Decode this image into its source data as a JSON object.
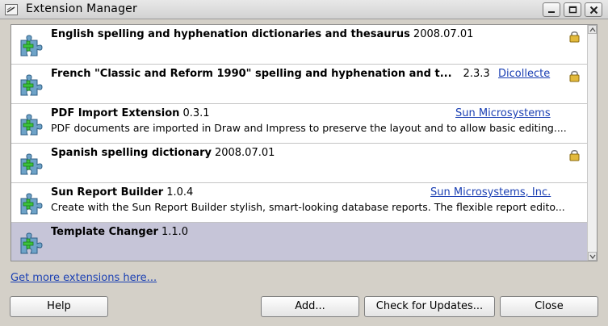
{
  "window": {
    "title": "Extension Manager",
    "buttons": [
      "minimize",
      "maximize",
      "close"
    ]
  },
  "extensions": [
    {
      "name": "English spelling and hyphenation dictionaries and thesaurus",
      "version": "2008.07.01",
      "publisher": "",
      "description": "",
      "locked": true,
      "selected": false
    },
    {
      "name": "French \"Classic and Reform 1990\" spelling and hyphenation and t...",
      "version": "2.3.3",
      "publisher": "Dicollecte",
      "description": "",
      "locked": true,
      "selected": false
    },
    {
      "name": "PDF Import Extension",
      "version": "0.3.1",
      "publisher": "Sun Microsystems",
      "description": "PDF documents are imported in Draw and Impress to preserve the layout and to allow basic editing....",
      "locked": false,
      "selected": false
    },
    {
      "name": "Spanish spelling dictionary",
      "version": "2008.07.01",
      "publisher": "",
      "description": "",
      "locked": true,
      "selected": false
    },
    {
      "name": "Sun Report Builder",
      "version": "1.0.4",
      "publisher": "Sun Microsystems, Inc.",
      "description": "Create with the Sun Report Builder stylish, smart-looking database reports. The flexible report edito...",
      "locked": false,
      "selected": false
    },
    {
      "name": "Template Changer",
      "version": "1.1.0",
      "publisher": "",
      "description": "",
      "locked": false,
      "selected": true
    }
  ],
  "links": {
    "get_more": "Get more extensions here..."
  },
  "buttons": {
    "help": "Help",
    "add": "Add...",
    "check_updates": "Check for Updates...",
    "close": "Close"
  },
  "colors": {
    "selection": "#c6c5d8",
    "link": "#1a3fb3",
    "puzzle_body": "#6ea3c8",
    "puzzle_plus": "#3cc43c"
  }
}
